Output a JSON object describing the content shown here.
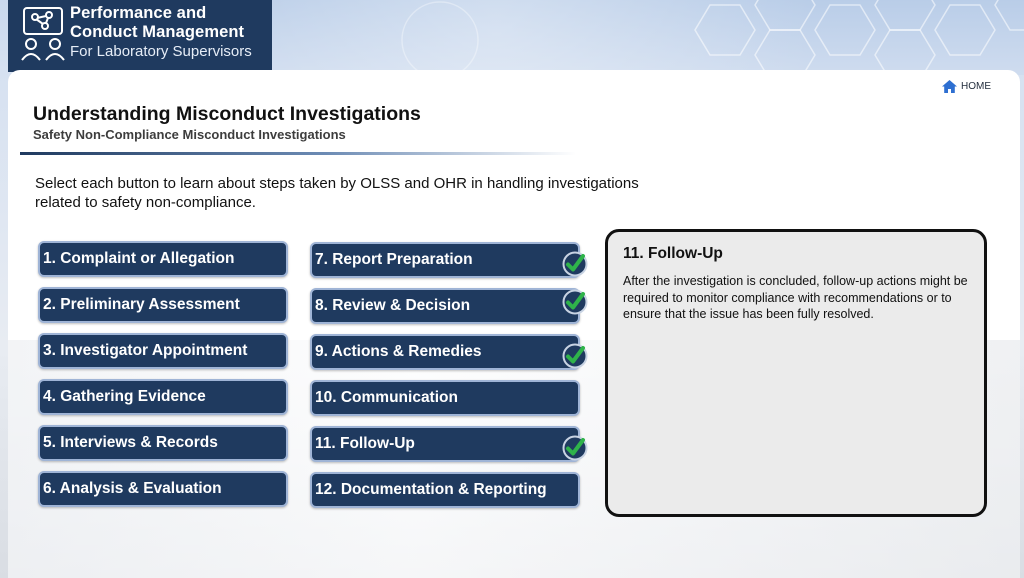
{
  "brand": {
    "title_line1": "Performance and",
    "title_line2": "Conduct Management",
    "subtitle": "For Laboratory Supervisors"
  },
  "nav": {
    "home_label": "HOME"
  },
  "page": {
    "title": "Understanding Misconduct Investigations",
    "subtitle": "Safety Non-Compliance Misconduct Investigations",
    "intro": "Select each button to learn about steps taken by OLSS and OHR in handling investigations related to safety non-compliance."
  },
  "steps": [
    {
      "label": "1. Complaint or Allegation",
      "visited": false
    },
    {
      "label": "2. Preliminary Assessment",
      "visited": false
    },
    {
      "label": "3. Investigator Appointment",
      "visited": false
    },
    {
      "label": "4. Gathering Evidence",
      "visited": false
    },
    {
      "label": "5. Interviews & Records",
      "visited": false
    },
    {
      "label": "6. Analysis & Evaluation",
      "visited": false
    },
    {
      "label": "7. Report Preparation",
      "visited": true
    },
    {
      "label": "8. Review & Decision",
      "visited": true
    },
    {
      "label": "9. Actions & Remedies",
      "visited": true
    },
    {
      "label": "10. Communication",
      "visited": false
    },
    {
      "label": "11. Follow-Up",
      "visited": true
    },
    {
      "label": "12. Documentation & Reporting",
      "visited": false
    }
  ],
  "detail": {
    "title": "11. Follow-Up",
    "body": "After the investigation is concluded, follow-up actions might be required to monitor compliance with recommendations or to ensure that the issue has been fully resolved."
  },
  "colors": {
    "navy": "#1f3a5f",
    "button_border": "#9fb4d6",
    "check_green": "#2fb34a"
  }
}
